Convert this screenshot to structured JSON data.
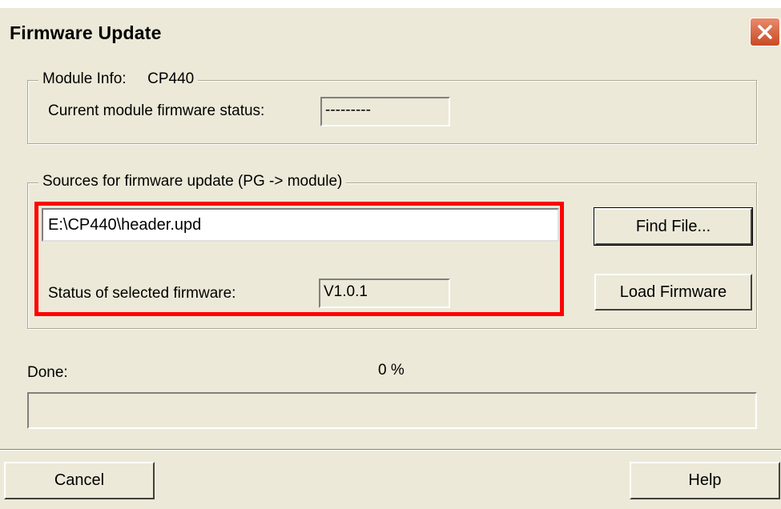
{
  "window": {
    "title": "Firmware Update",
    "close_icon": "close-icon"
  },
  "module_info": {
    "legend": "Module Info:",
    "module_name": "CP440",
    "status_label": "Current module firmware status:",
    "status_value": "---------"
  },
  "sources": {
    "legend": "Sources for firmware update  (PG -> module)",
    "file_path": "E:\\CP440\\header.upd",
    "selected_status_label": "Status of selected firmware:",
    "selected_status_value": "V1.0.1",
    "find_file_label": "Find File...",
    "load_firmware_label": "Load Firmware"
  },
  "progress": {
    "done_label": "Done:",
    "percent_text": "0 %",
    "percent_value": 0
  },
  "footer": {
    "cancel_label": "Cancel",
    "help_label": "Help"
  },
  "colors": {
    "highlight": "#ff0000",
    "dialog_bg": "#ece9d8",
    "close_button": "#c94a25"
  }
}
